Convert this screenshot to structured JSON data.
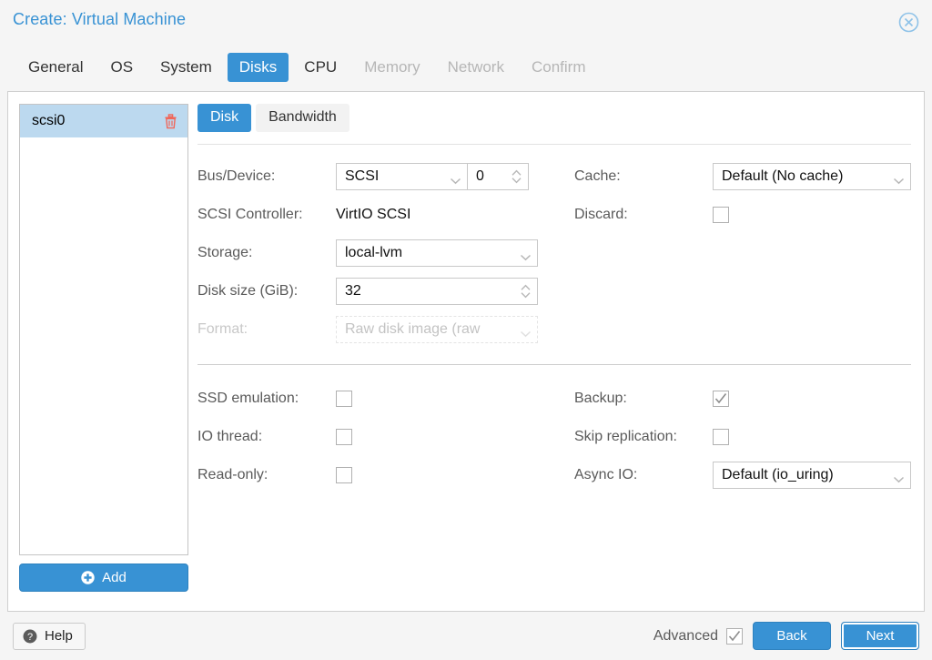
{
  "window": {
    "title": "Create: Virtual Machine",
    "close_icon": "close-circle-icon"
  },
  "tabs": [
    {
      "label": "General",
      "state": "enabled"
    },
    {
      "label": "OS",
      "state": "enabled"
    },
    {
      "label": "System",
      "state": "enabled"
    },
    {
      "label": "Disks",
      "state": "active"
    },
    {
      "label": "CPU",
      "state": "enabled"
    },
    {
      "label": "Memory",
      "state": "disabled"
    },
    {
      "label": "Network",
      "state": "disabled"
    },
    {
      "label": "Confirm",
      "state": "disabled"
    }
  ],
  "sidebar": {
    "items": [
      {
        "label": "scsi0",
        "selected": true,
        "delete_icon": "trash-icon"
      }
    ],
    "add_button": {
      "label": "Add",
      "icon": "plus-circle-icon"
    }
  },
  "subtabs": [
    {
      "label": "Disk",
      "state": "active"
    },
    {
      "label": "Bandwidth",
      "state": "enabled"
    }
  ],
  "form": {
    "bus_device": {
      "label": "Bus/Device:",
      "bus_value": "SCSI",
      "device_value": "0"
    },
    "scsi_controller": {
      "label": "SCSI Controller:",
      "value": "VirtIO SCSI"
    },
    "storage": {
      "label": "Storage:",
      "value": "local-lvm"
    },
    "disk_size": {
      "label": "Disk size (GiB):",
      "value": "32"
    },
    "format": {
      "label": "Format:",
      "value": "Raw disk image (raw",
      "disabled": true
    },
    "cache": {
      "label": "Cache:",
      "value": "Default (No cache)"
    },
    "discard": {
      "label": "Discard:",
      "checked": false
    },
    "ssd_emulation": {
      "label": "SSD emulation:",
      "checked": false
    },
    "io_thread": {
      "label": "IO thread:",
      "checked": false
    },
    "read_only": {
      "label": "Read-only:",
      "checked": false
    },
    "backup": {
      "label": "Backup:",
      "checked": true
    },
    "skip_replication": {
      "label": "Skip replication:",
      "checked": false
    },
    "async_io": {
      "label": "Async IO:",
      "value": "Default (io_uring)"
    }
  },
  "footer": {
    "help": {
      "label": "Help",
      "icon": "question-circle-icon"
    },
    "advanced": {
      "label": "Advanced",
      "checked": true
    },
    "back": "Back",
    "next": "Next"
  },
  "colors": {
    "accent": "#3892d4",
    "selected_row": "#bcd9ef",
    "trash": "#f0675a",
    "header_bg": "#f5f5f5"
  }
}
